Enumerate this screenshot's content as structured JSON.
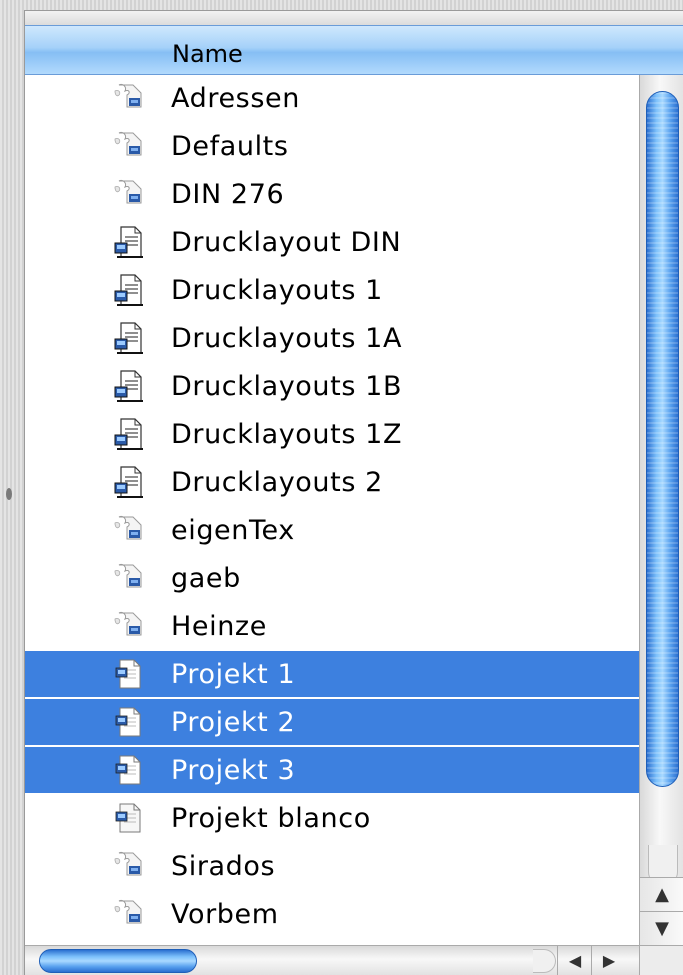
{
  "list": {
    "column_header": "Name",
    "items": [
      {
        "label": "Adressen",
        "icon": "database-file-icon",
        "selected": false
      },
      {
        "label": "Defaults",
        "icon": "database-file-icon",
        "selected": false
      },
      {
        "label": "DIN 276",
        "icon": "database-file-icon",
        "selected": false
      },
      {
        "label": "Drucklayout DIN",
        "icon": "layout-document-icon",
        "selected": false
      },
      {
        "label": "Drucklayouts 1",
        "icon": "layout-document-icon",
        "selected": false
      },
      {
        "label": "Drucklayouts 1A",
        "icon": "layout-document-icon",
        "selected": false
      },
      {
        "label": "Drucklayouts 1B",
        "icon": "layout-document-icon",
        "selected": false
      },
      {
        "label": "Drucklayouts 1Z",
        "icon": "layout-document-icon",
        "selected": false
      },
      {
        "label": "Drucklayouts 2",
        "icon": "layout-document-icon",
        "selected": false
      },
      {
        "label": "eigenTex",
        "icon": "database-file-icon",
        "selected": false
      },
      {
        "label": "gaeb",
        "icon": "database-file-icon",
        "selected": false
      },
      {
        "label": "Heinze",
        "icon": "database-file-icon",
        "selected": false
      },
      {
        "label": "Projekt 1",
        "icon": "project-document-icon",
        "selected": true
      },
      {
        "label": "Projekt 2",
        "icon": "project-document-icon",
        "selected": true
      },
      {
        "label": "Projekt 3",
        "icon": "project-document-icon",
        "selected": true
      },
      {
        "label": "Projekt blanco",
        "icon": "project-document-icon",
        "selected": false
      },
      {
        "label": "Sirados",
        "icon": "database-file-icon",
        "selected": false
      },
      {
        "label": "Vorbem",
        "icon": "database-file-icon",
        "selected": false
      }
    ]
  },
  "colors": {
    "selection": "#3d80df",
    "header": "#a5d1f9",
    "scroll_thumb": "#5aa2ef"
  },
  "scrollbar_icons": {
    "up": "arrow-up-icon",
    "down": "arrow-down-icon",
    "left": "arrow-left-icon",
    "right": "arrow-right-icon"
  }
}
